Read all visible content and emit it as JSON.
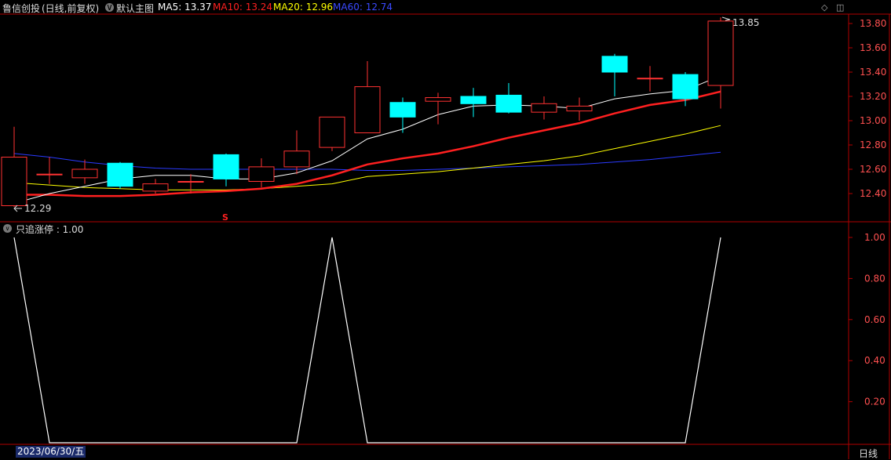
{
  "header": {
    "stock_name": "鲁信创投",
    "mode": "(日线,前复权)",
    "main_chart_label": "默认主图",
    "ma5": {
      "label": "MA5: 13.37",
      "color": "#ffffff"
    },
    "ma10": {
      "label": "MA10: 13.24",
      "color": "#ff2020"
    },
    "ma20": {
      "label": "MA20: 12.96",
      "color": "#ffff00"
    },
    "ma60": {
      "label": "MA60: 12.74",
      "color": "#2a3aff"
    }
  },
  "indicator": {
    "label": "只追涨停 : 1.00",
    "values": [
      1,
      0,
      0,
      0,
      0,
      0,
      0,
      0,
      0,
      1,
      0,
      0,
      0,
      0,
      0,
      0,
      0,
      0,
      0,
      0,
      1
    ]
  },
  "annotations": {
    "high_label": "13.85",
    "low_label": "12.29",
    "signal_marker": "S"
  },
  "footer": {
    "date": "2023/06/30/五",
    "period": "日线"
  },
  "colors": {
    "up": "#ff3232",
    "down": "#00ffff",
    "axis": "#b00000",
    "text_axis": "#ff5050"
  },
  "chart_data": {
    "type": "candlestick",
    "ylim": [
      12.29,
      13.85
    ],
    "y_ticks": [
      "13.80",
      "13.60",
      "13.40",
      "13.20",
      "13.00",
      "12.80",
      "12.60",
      "12.40"
    ],
    "sub_ylim": [
      0,
      1.0
    ],
    "sub_ticks": [
      "1.00",
      "0.80",
      "0.60",
      "0.40",
      "0.20"
    ],
    "candles": [
      {
        "o": 12.3,
        "c": 12.7,
        "h": 12.95,
        "l": 12.29
      },
      {
        "o": 12.56,
        "c": 12.56,
        "h": 12.7,
        "l": 12.48
      },
      {
        "o": 12.53,
        "c": 12.6,
        "h": 12.68,
        "l": 12.48
      },
      {
        "o": 12.65,
        "c": 12.46,
        "h": 12.66,
        "l": 12.44
      },
      {
        "o": 12.42,
        "c": 12.48,
        "h": 12.52,
        "l": 12.4
      },
      {
        "o": 12.5,
        "c": 12.5,
        "h": 12.56,
        "l": 12.4
      },
      {
        "o": 12.72,
        "c": 12.52,
        "h": 12.73,
        "l": 12.46
      },
      {
        "o": 12.5,
        "c": 12.62,
        "h": 12.69,
        "l": 12.45
      },
      {
        "o": 12.62,
        "c": 12.75,
        "h": 12.92,
        "l": 12.56
      },
      {
        "o": 12.78,
        "c": 13.03,
        "h": 13.03,
        "l": 12.75
      },
      {
        "o": 12.9,
        "c": 13.28,
        "h": 13.49,
        "l": 12.9
      },
      {
        "o": 13.15,
        "c": 13.03,
        "h": 13.19,
        "l": 12.9
      },
      {
        "o": 13.16,
        "c": 13.19,
        "h": 13.23,
        "l": 12.97
      },
      {
        "o": 13.2,
        "c": 13.14,
        "h": 13.27,
        "l": 13.03
      },
      {
        "o": 13.21,
        "c": 13.07,
        "h": 13.31,
        "l": 13.06
      },
      {
        "o": 13.07,
        "c": 13.14,
        "h": 13.2,
        "l": 13.01
      },
      {
        "o": 13.08,
        "c": 13.12,
        "h": 13.19,
        "l": 13.0
      },
      {
        "o": 13.53,
        "c": 13.4,
        "h": 13.55,
        "l": 13.2
      },
      {
        "o": 13.35,
        "c": 13.35,
        "h": 13.45,
        "l": 13.24
      },
      {
        "o": 13.38,
        "c": 13.18,
        "h": 13.4,
        "l": 13.12
      },
      {
        "o": 13.29,
        "c": 13.82,
        "h": 13.85,
        "l": 13.1
      }
    ],
    "ma5": [
      12.32,
      12.4,
      12.46,
      12.52,
      12.55,
      12.55,
      12.52,
      12.52,
      12.57,
      12.67,
      12.85,
      12.93,
      13.05,
      13.12,
      13.13,
      13.12,
      13.1,
      13.18,
      13.22,
      13.25,
      13.37
    ],
    "ma10": [
      12.39,
      12.39,
      12.38,
      12.38,
      12.39,
      12.41,
      12.42,
      12.44,
      12.48,
      12.55,
      12.64,
      12.69,
      12.73,
      12.79,
      12.86,
      12.92,
      12.98,
      13.06,
      13.13,
      13.17,
      13.24
    ],
    "ma20": [
      12.49,
      12.47,
      12.45,
      12.44,
      12.43,
      12.43,
      12.43,
      12.44,
      12.46,
      12.48,
      12.54,
      12.56,
      12.58,
      12.61,
      12.64,
      12.67,
      12.71,
      12.77,
      12.83,
      12.89,
      12.96
    ],
    "ma60": [
      12.73,
      12.7,
      12.66,
      12.63,
      12.61,
      12.6,
      12.6,
      12.6,
      12.6,
      12.6,
      12.59,
      12.59,
      12.6,
      12.61,
      12.62,
      12.63,
      12.64,
      12.66,
      12.68,
      12.71,
      12.74
    ]
  }
}
